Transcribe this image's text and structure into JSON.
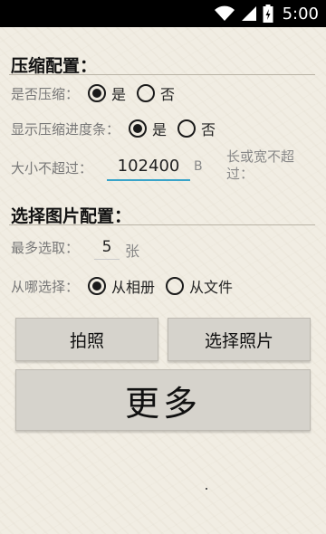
{
  "status_bar": {
    "time": "5:00",
    "icons": [
      "wifi-icon",
      "signal-icon",
      "battery-icon"
    ]
  },
  "compress_config": {
    "title": "压缩配置：",
    "compress_label": "是否压缩：",
    "compress_options": {
      "yes": "是",
      "no": "否",
      "selected": "yes"
    },
    "progress_label": "显示压缩进度条：",
    "progress_options": {
      "yes": "是",
      "no": "否",
      "selected": "yes"
    },
    "size_label": "大小不超过：",
    "size_value": "102400",
    "size_unit": "B",
    "size_hint": "长或宽不超过："
  },
  "pick_config": {
    "title": "选择图片配置：",
    "max_label": "最多选取：",
    "max_value": "5",
    "max_unit": "张",
    "source_label": "从哪选择：",
    "source_options": {
      "album": "从相册",
      "file": "从文件",
      "selected": "album"
    }
  },
  "buttons": {
    "take_photo": "拍照",
    "choose_photo": "选择照片",
    "more": "更多"
  },
  "colors": {
    "accent_underline": "#3aa4c9",
    "background": "#f1ede3",
    "button_bg": "#d6d3cc"
  }
}
